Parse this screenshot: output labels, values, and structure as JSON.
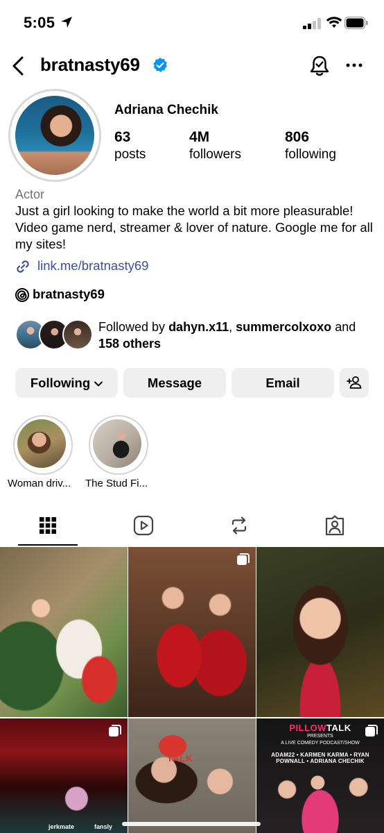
{
  "status_bar": {
    "time": "5:05"
  },
  "header": {
    "username": "bratnasty69"
  },
  "profile": {
    "full_name": "Adriana Chechik",
    "stats": [
      {
        "value": "63",
        "label": "posts"
      },
      {
        "value": "4M",
        "label": "followers"
      },
      {
        "value": "806",
        "label": "following"
      }
    ],
    "category": "Actor",
    "bio": "Just a girl looking to make the world a bit more pleasurable! Video game nerd, streamer & lover of nature. Google me for all my sites!",
    "link": "link.me/bratnasty69",
    "threads_handle": "bratnasty69"
  },
  "followed_by": {
    "prefix": "Followed by ",
    "user1": "dahyn.x11",
    "separator": ", ",
    "user2": "summercolxoxo",
    "conj": " and ",
    "others": "158 others"
  },
  "actions": {
    "following": "Following",
    "message": "Message",
    "email": "Email"
  },
  "highlights": [
    {
      "label": "Woman driv..."
    },
    {
      "label": "The Stud Fi..."
    }
  ],
  "tabs": [
    {
      "name": "grid-icon",
      "active": true
    },
    {
      "name": "reels-icon",
      "active": false
    },
    {
      "name": "reposts-icon",
      "active": false
    },
    {
      "name": "tagged-icon",
      "active": false
    }
  ],
  "posts": {
    "p5_brand": "TALK",
    "p6": {
      "title_a": "PILLOW",
      "title_b": "TALK",
      "presents": "PRESENTS",
      "line": "A LIVE COMEDY PODCAST/SHOW",
      "names": "ADAM22 • KARMEN KARMA • RYAN POWNALL • ADRIANA CHECHIK"
    },
    "p4_sponsors": [
      "jerkmate",
      "fansly"
    ]
  },
  "colors": {
    "link": "#3b4f9e",
    "verified": "#0095f6",
    "button_bg": "#efefef",
    "muted": "#737373"
  }
}
